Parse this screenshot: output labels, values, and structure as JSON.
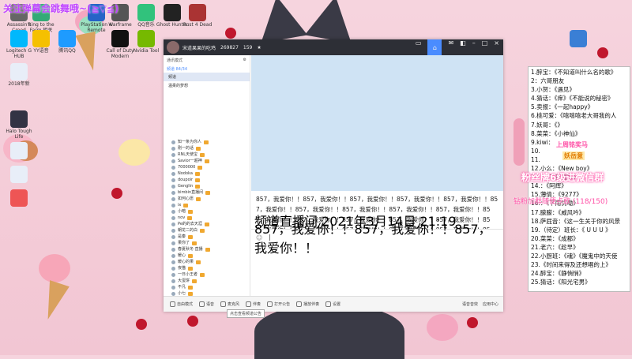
{
  "overlay": {
    "title": "关注弹幕会跳舞哦~(≧▽≦)"
  },
  "desktop_icons": [
    {
      "label": "Assassin's Creed"
    },
    {
      "label": "Ring to the Farm 相关"
    },
    {
      "label": "PlayStation 4 Remote"
    },
    {
      "label": "Warframe"
    },
    {
      "label": "QQ音乐"
    },
    {
      "label": "Ghost Hunter"
    },
    {
      "label": "Rust 4 Dead"
    },
    {
      "label": "Logitech G HUB"
    },
    {
      "label": "YY语音"
    },
    {
      "label": "腾讯QQ"
    },
    {
      "label": "Call of Duty Modern"
    },
    {
      "label": "Nvidia Tool"
    },
    {
      "label": "2018年新"
    },
    {
      "label": "Halo Tough Life"
    }
  ],
  "window": {
    "title": "宋道果果的吃鸡",
    "id": "269827",
    "count": "159"
  },
  "left_panel": {
    "mode": "通讯模式",
    "online": "84/34",
    "guild": "频道 84/34",
    "channels": [
      "频道",
      "温柔的梦想"
    ],
    "members": [
      "知一条为你人",
      "刚一的话",
      "RNL天使宝",
      "Savior一超神",
      "7000000",
      "Nodoka",
      "doupoir",
      "Genglin",
      "bimbin直播间",
      "如何心愿",
      "ix",
      "小暗",
      "nov",
      "Pe的的去天涯",
      "朝龙二的白",
      "是秦",
      "果你了",
      "春夏秋冬·直播",
      "暖心",
      "暖心的果",
      "夜猫",
      "一日小王者",
      "大蛋饼",
      "不凡",
      "小七"
    ]
  },
  "chat": {
    "message": "857，我爱你！！857，我爱你！！857，我爱你！！857，我爱你！！857，我爱你！！857，我爱你！！857，我爱你！！857，我爱你！！857，我爱你！！857，我爱你！！857，我爱你！！857，我爱你！！857，我爱你！！857，我爱你！！857，我爱你！！857，我爱你！！857，我爱你！！857，我爱你！！857，我爱你！！857，我爱你！！857，我爱你！！857，我爱你！！857，我爱你！！857，我爱你！！",
    "system_meta": "频道直播间 2021年3月14日 21:19",
    "system_msg": "857，我爱你！！857，我爱你！！857，我爱你！！"
  },
  "bottom_bar": {
    "items": [
      "自由模式",
      "语音",
      "麦克风",
      "伴奏",
      "打开公告",
      "播放伴奏",
      "设置"
    ],
    "right": [
      "语音音效",
      "应用中心"
    ]
  },
  "tooltip": "点击查看频道公告",
  "songs": [
    "1.醉宝：《不知道叫什么名的歌》",
    "2：六哥朋友",
    "3.小贺：《遇见》",
    "4.猜话：《痒》《不能说的秘密》",
    "5.卖报：《一起happy》",
    "6.桃可爱：《嘻嘻嘻老大哥我的人",
    "7.妖哥：《》",
    "8.菜菜：《小神仙》",
    "9.kiwi：",
    "10.",
    "11.",
    "12.小么：《New boy》",
    "13.：《不再犹豫》",
    "14.：《阿辉》",
    "15.薄倩：《9277》",
    "16.：《下雨优嘞》",
    "17.朦朦：《威风吟》",
    "18.萨屁音：《这一生关于你的风景",
    "19.（待定）班长：《 U U U 》",
    "20.菜菜：《成都》",
    "21.老六：《趁早》",
    "22.小厨班：《魂》《魔鬼中的天使",
    "23.《时间来得及还想唱的上》",
    "24.醉宝：《静悄悄》",
    "25.猜话：《阳光宅男》"
  ],
  "overlay_badges": {
    "sticker1": "上周铭奖马",
    "sticker2": "妖岳意",
    "fan_group": "粉丝牌6级进微信群",
    "fan_sub": "钻粉加群随便点歌 (118/150)"
  }
}
